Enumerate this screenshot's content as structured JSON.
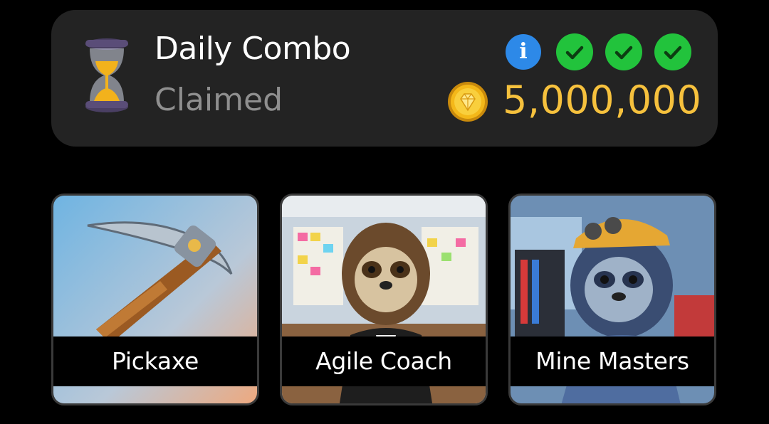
{
  "combo": {
    "title": "Daily Combo",
    "status": "Claimed",
    "info_symbol": "i",
    "reward": "5,000,000",
    "icons": {
      "timer": "hourglass-icon",
      "info": "info-icon",
      "checks": [
        "check-icon",
        "check-icon",
        "check-icon"
      ],
      "coin": "coin-icon"
    },
    "colors": {
      "reward": "#f6c13d",
      "check": "#22c33c",
      "info": "#2d89e8"
    }
  },
  "cards": [
    {
      "label": "Pickaxe"
    },
    {
      "label": "Agile Coach"
    },
    {
      "label": "Mine Masters"
    }
  ]
}
